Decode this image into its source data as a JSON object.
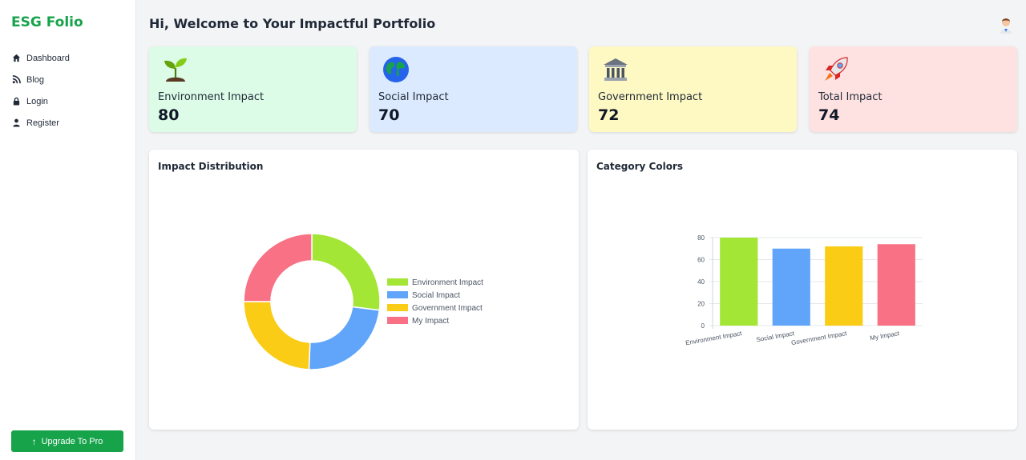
{
  "app": {
    "brand": "ESG Folio"
  },
  "sidebar": {
    "items": [
      {
        "label": "Dashboard",
        "icon": "home-icon"
      },
      {
        "label": "Blog",
        "icon": "rss-icon"
      },
      {
        "label": "Login",
        "icon": "lock-icon"
      },
      {
        "label": "Register",
        "icon": "user-icon"
      }
    ],
    "upgrade_label": "Upgrade To Pro"
  },
  "header": {
    "title": "Hi, Welcome to Your Impactful Portfolio",
    "avatar_icon": "user-avatar-icon"
  },
  "cards": [
    {
      "label": "Environment Impact",
      "value": "80",
      "icon": "seedling-icon",
      "bg": "#dcfce7"
    },
    {
      "label": "Social Impact",
      "value": "70",
      "icon": "globe-icon",
      "bg": "#dbeafe"
    },
    {
      "label": "Government Impact",
      "value": "72",
      "icon": "bank-icon",
      "bg": "#fef9c3"
    },
    {
      "label": "Total Impact",
      "value": "74",
      "icon": "rocket-icon",
      "bg": "#fee2e2"
    }
  ],
  "panels": {
    "distribution_title": "Impact Distribution",
    "colors_title": "Category Colors"
  },
  "chart_data": [
    {
      "type": "pie",
      "variant": "doughnut",
      "title": "Impact Distribution",
      "categories": [
        "Environment Impact",
        "Social Impact",
        "Government Impact",
        "My Impact"
      ],
      "values": [
        80,
        70,
        72,
        74
      ],
      "colors": [
        "#a3e635",
        "#60a5fa",
        "#facc15",
        "#f87185"
      ],
      "legend": "right"
    },
    {
      "type": "bar",
      "title": "Category Colors",
      "categories": [
        "Environment Impact",
        "Social Impact",
        "Government Impact",
        "My Impact"
      ],
      "values": [
        80,
        70,
        72,
        74
      ],
      "colors": [
        "#a3e635",
        "#60a5fa",
        "#facc15",
        "#f87185"
      ],
      "ylim": [
        0,
        80
      ],
      "yticks": [
        "0",
        "20",
        "40",
        "60",
        "80"
      ],
      "grid": true,
      "legend": "none"
    }
  ]
}
